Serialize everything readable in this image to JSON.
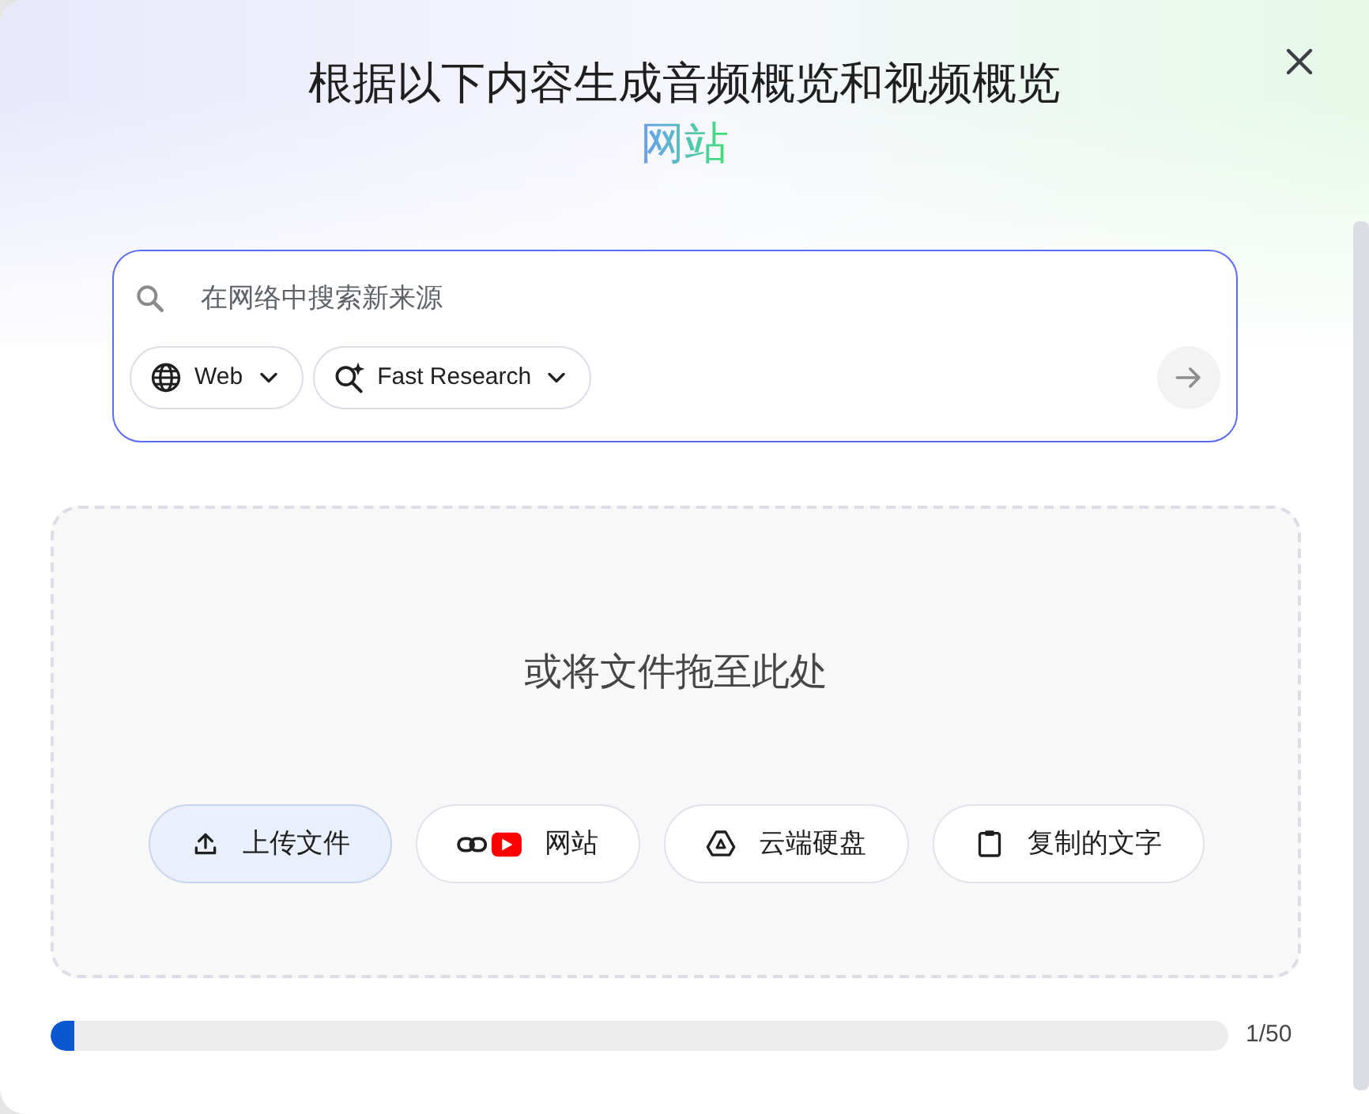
{
  "dialog": {
    "title": "根据以下内容生成音频概览和视频概览",
    "subtitle": "网站"
  },
  "search": {
    "placeholder": "在网络中搜索新来源",
    "chips": [
      {
        "kind": "globe",
        "label": "Web"
      },
      {
        "kind": "sparkle-search",
        "label": "Fast Research"
      }
    ]
  },
  "dropzone": {
    "prompt": "或将文件拖至此处",
    "buttons": [
      {
        "kind": "upload",
        "label": "上传文件",
        "selected": true
      },
      {
        "kind": "link-video",
        "label": "网站",
        "selected": false
      },
      {
        "kind": "drive",
        "label": "云端硬盘",
        "selected": false
      },
      {
        "kind": "clipboard",
        "label": "复制的文字",
        "selected": false
      }
    ]
  },
  "source_limit": {
    "level": 0.02,
    "count": "1/50"
  }
}
